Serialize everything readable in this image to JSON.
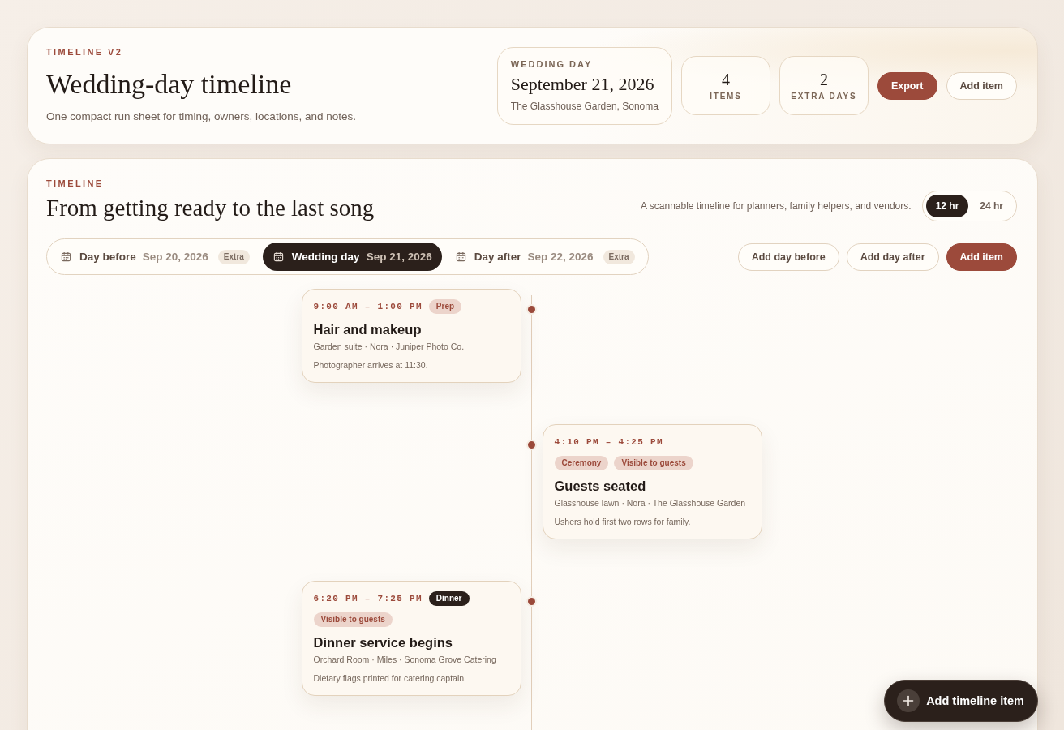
{
  "header": {
    "eyebrow": "TIMELINE V2",
    "title": "Wedding-day timeline",
    "subtitle": "One compact run sheet for timing, owners, locations, and notes.",
    "event": {
      "label": "WEDDING DAY",
      "date": "September 21, 2026",
      "venue": "The Glasshouse Garden, Sonoma"
    },
    "stats": [
      {
        "value": "4",
        "label": "ITEMS"
      },
      {
        "value": "2",
        "label": "EXTRA DAYS"
      }
    ],
    "buttons": [
      {
        "label": "Export",
        "kind": "primary"
      },
      {
        "label": "Add item",
        "kind": "outline"
      }
    ]
  },
  "timeline": {
    "eyebrow": "TIMELINE",
    "title": "From getting ready to the last song",
    "description": "A scannable timeline for planners, family helpers, and vendors.",
    "clock_formats": [
      {
        "label": "12 hr",
        "selected": true
      },
      {
        "label": "24 hr",
        "selected": false
      }
    ],
    "days": [
      {
        "label": "Day before",
        "date": "Sep 20, 2026",
        "badge": "Extra",
        "selected": false
      },
      {
        "label": "Wedding day",
        "date": "Sep 21, 2026",
        "selected": true
      },
      {
        "label": "Day after",
        "date": "Sep 22, 2026",
        "badge": "Extra",
        "selected": false
      }
    ],
    "actions": [
      {
        "label": "Add day before",
        "kind": "outline"
      },
      {
        "label": "Add day after",
        "kind": "outline"
      },
      {
        "label": "Add item",
        "kind": "primary"
      }
    ],
    "items": [
      {
        "kind": "left",
        "time": "9:00 AM – 1:00 PM",
        "inline_tags": [
          {
            "label": "Prep",
            "kind": "soft"
          }
        ],
        "title": "Hair and makeup",
        "details": "Garden suite · Nora · Juniper Photo Co.",
        "note": "Photographer arrives at 11:30."
      },
      {
        "kind": "right",
        "time": "4:10 PM – 4:25 PM",
        "tags": [
          {
            "label": "Ceremony",
            "kind": "soft"
          },
          {
            "label": "Visible to guests",
            "kind": "soft"
          }
        ],
        "title": "Guests seated",
        "details": "Glasshouse lawn · Nora · The Glasshouse Garden",
        "note": "Ushers hold first two rows for family."
      },
      {
        "kind": "left",
        "time": "6:20 PM – 7:25 PM",
        "inline_tags": [
          {
            "label": "Dinner",
            "kind": "solid"
          }
        ],
        "tags": [
          {
            "label": "Visible to guests",
            "kind": "soft"
          }
        ],
        "title": "Dinner service begins",
        "details": "Orchard Room · Miles · Sonoma Grove Catering",
        "note": "Dietary flags printed for catering captain."
      }
    ]
  },
  "fab": {
    "label": "Add timeline item"
  }
}
